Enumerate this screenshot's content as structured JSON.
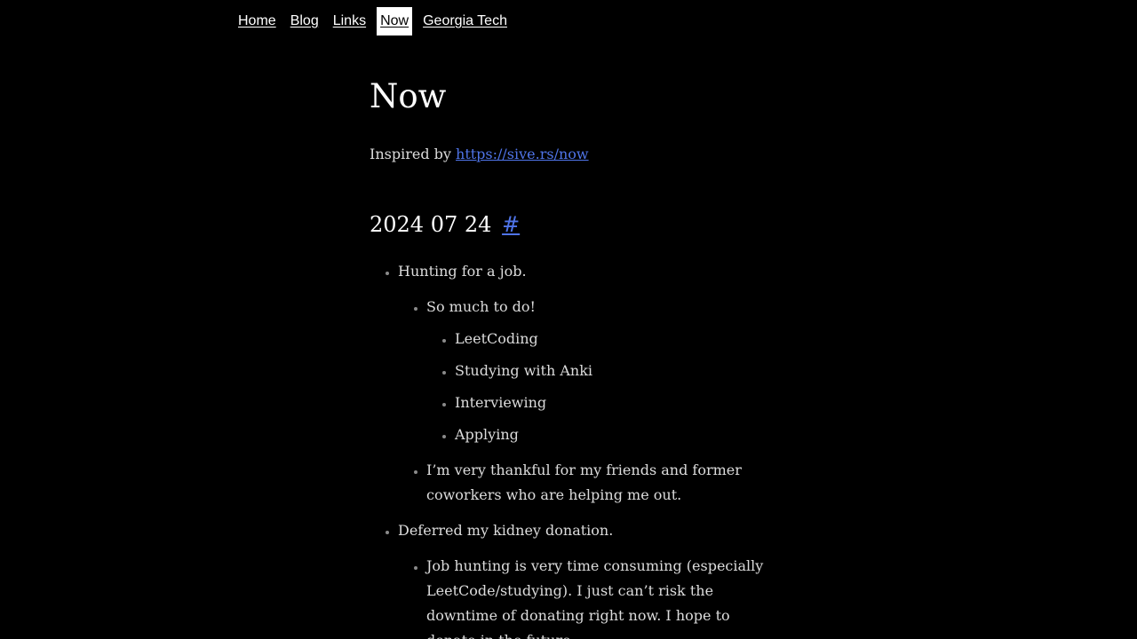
{
  "nav": {
    "items": [
      {
        "label": "Home",
        "active": false
      },
      {
        "label": "Blog",
        "active": false
      },
      {
        "label": "Links",
        "active": false
      },
      {
        "label": "Now",
        "active": true
      },
      {
        "label": "Georgia Tech",
        "active": false
      }
    ]
  },
  "page": {
    "title": "Now",
    "inspired_prefix": "Inspired by ",
    "inspired_link": "https://sive.rs/now"
  },
  "entry": {
    "date": "2024 07 24",
    "anchor": "#",
    "items": [
      {
        "text": "Hunting for a job.",
        "children": [
          {
            "text": "So much to do!",
            "children": [
              {
                "text": "LeetCoding"
              },
              {
                "text": "Studying with Anki"
              },
              {
                "text": "Interviewing"
              },
              {
                "text": "Applying"
              }
            ]
          },
          {
            "text": "I’m very thankful for my friends and former coworkers who are helping me out."
          }
        ]
      },
      {
        "text": "Deferred my kidney donation.",
        "children": [
          {
            "text": "Job hunting is very time consuming (especially LeetCode/studying). I just can’t risk the downtime of donating right now. I hope to donate in the future."
          }
        ]
      }
    ]
  },
  "colors": {
    "background": "#000000",
    "text": "#dcdcdc",
    "link": "#4f74e8",
    "nav_active_bg": "#ffffff"
  }
}
